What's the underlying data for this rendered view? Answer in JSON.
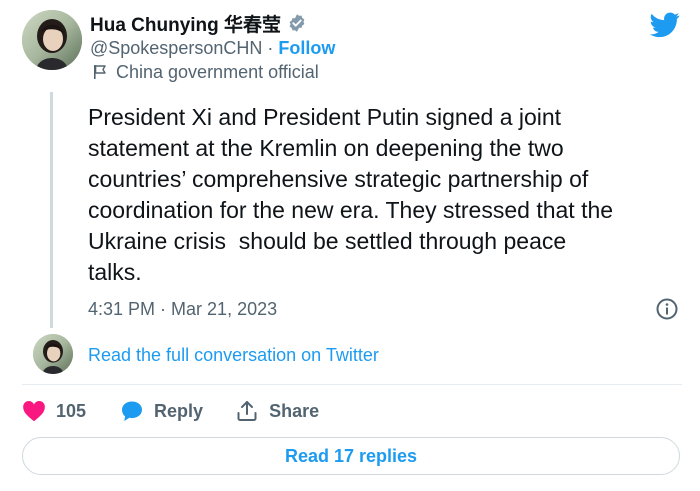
{
  "author": {
    "display_name": "Hua Chunying 华春莹",
    "handle": "@SpokespersonCHN",
    "separator": "·",
    "follow_label": "Follow",
    "affiliation_label": "China government official",
    "verified": true
  },
  "tweet": {
    "text": "President Xi and President Putin signed a joint\nstatement at the Kremlin on deepening the two\ncountries’ comprehensive strategic partnership of\ncoordination for the new era. They stressed that the\nUkraine crisis  should be settled through peace\ntalks.",
    "time": "4:31 PM",
    "separator": "·",
    "date": "Mar 21, 2023"
  },
  "conversation": {
    "read_full_label": "Read the full conversation on Twitter"
  },
  "actions": {
    "like_count": "105",
    "reply_label": "Reply",
    "share_label": "Share"
  },
  "replies": {
    "read_label": "Read 17 replies"
  },
  "colors": {
    "accent": "#1d9bf0",
    "like": "#f91880",
    "text_primary": "#0f1419",
    "text_secondary": "#536471",
    "border": "#cfd9de"
  },
  "icons": {
    "verified": "verified-badge-icon",
    "flag": "government-flag-icon",
    "brand": "twitter-bird-icon",
    "info": "info-icon",
    "like": "heart-icon",
    "reply": "speech-bubble-icon",
    "share": "share-upload-icon"
  }
}
